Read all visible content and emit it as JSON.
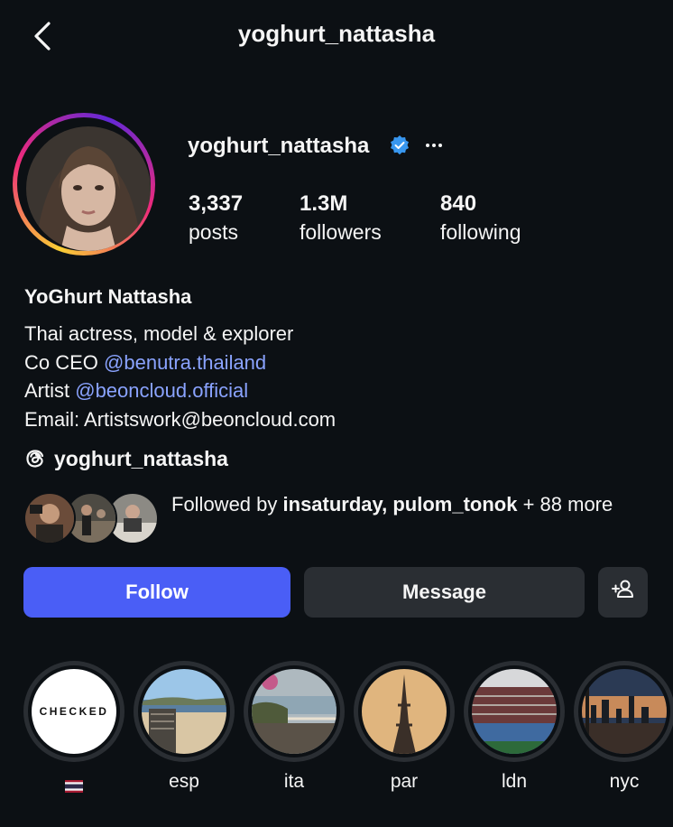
{
  "header": {
    "title": "yoghurt_nattasha"
  },
  "profile": {
    "username": "yoghurt_nattasha",
    "verified": true,
    "stats": [
      {
        "value": "3,337",
        "label": "posts"
      },
      {
        "value": "1.3M",
        "label": "followers"
      },
      {
        "value": "840",
        "label": "following"
      }
    ],
    "display_name": "YoGhurt Nattasha",
    "bio": {
      "line1": "Thai actress, model & explorer",
      "line2_prefix": "Co CEO ",
      "line2_mention": "@benutra.thailand",
      "line3_prefix": "Artist ",
      "line3_mention": "@beoncloud.official",
      "line4": "Email: Artistswork@beoncloud.com"
    },
    "threads_handle": "yoghurt_nattasha",
    "followed_by": {
      "prefix": "Followed by ",
      "names": "insaturday, pulom_tonok",
      "suffix": " + 88 more"
    }
  },
  "actions": {
    "follow": "Follow",
    "message": "Message"
  },
  "highlights": [
    {
      "label": "",
      "cover_text": "CHECKED",
      "flag": "thai-flag"
    },
    {
      "label": "esp"
    },
    {
      "label": "ita"
    },
    {
      "label": "par"
    },
    {
      "label": "ldn"
    },
    {
      "label": "nyc"
    }
  ],
  "colors": {
    "background": "#0c1014",
    "follow_button": "#4a5ef6",
    "secondary_button": "#2a2e33",
    "mention": "#8aa3ff",
    "verified_badge": "#3897f0"
  },
  "icons": [
    "back-chevron-icon",
    "verified-badge-icon",
    "more-options-icon",
    "threads-icon",
    "add-person-icon"
  ]
}
